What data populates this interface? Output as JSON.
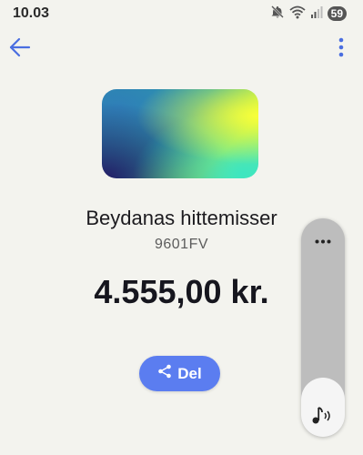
{
  "status_bar": {
    "time": "10.03",
    "battery": "59",
    "icons": [
      "mute-icon",
      "wifi-icon",
      "signal-icon"
    ]
  },
  "app_bar": {
    "back_icon": "arrow-left-icon",
    "menu_icon": "more-vert-icon"
  },
  "detail": {
    "merchant": "Beydanas hittemisser",
    "reference": "9601FV",
    "amount": "4.555,00 kr."
  },
  "share_button": {
    "label": "Del",
    "icon": "share-icon"
  },
  "volume_panel": {
    "level": 0.27,
    "icon": "music-note-icon"
  },
  "colors": {
    "background": "#f3f3ee",
    "accent": "#5b7df0",
    "icon_blue": "#4a6ee0"
  }
}
